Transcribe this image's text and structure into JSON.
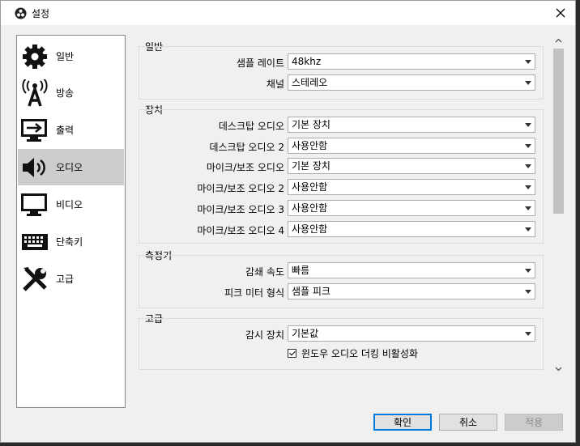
{
  "window": {
    "title": "설정"
  },
  "sidebar": {
    "items": [
      {
        "label": "일반",
        "icon": "gear-icon"
      },
      {
        "label": "방송",
        "icon": "broadcast-antenna-icon"
      },
      {
        "label": "출력",
        "icon": "output-monitor-icon"
      },
      {
        "label": "오디오",
        "icon": "speaker-icon",
        "selected": true
      },
      {
        "label": "비디오",
        "icon": "monitor-icon"
      },
      {
        "label": "단축키",
        "icon": "keyboard-icon"
      },
      {
        "label": "고급",
        "icon": "tools-icon"
      }
    ]
  },
  "general": {
    "title": "일반",
    "rows": [
      {
        "label": "샘플 레이트",
        "value": "48khz"
      },
      {
        "label": "채널",
        "value": "스테레오"
      }
    ]
  },
  "devices": {
    "title": "장치",
    "rows": [
      {
        "label": "데스크탑 오디오",
        "value": "기본 장치"
      },
      {
        "label": "데스크탑 오디오 2",
        "value": "사용안함"
      },
      {
        "label": "마이크/보조 오디오",
        "value": "기본 장치"
      },
      {
        "label": "마이크/보조 오디오 2",
        "value": "사용안함"
      },
      {
        "label": "마이크/보조 오디오 3",
        "value": "사용안함"
      },
      {
        "label": "마이크/보조 오디오 4",
        "value": "사용안함"
      }
    ]
  },
  "meters": {
    "title": "측정기",
    "rows": [
      {
        "label": "감쇄 속도",
        "value": "빠름"
      },
      {
        "label": "피크 미터 형식",
        "value": "샘플 피크"
      }
    ]
  },
  "advanced": {
    "title": "고급",
    "rows": [
      {
        "label": "감시 장치",
        "value": "기본값"
      }
    ],
    "checkbox": {
      "label": "윈도우 오디오 더킹 비활성화",
      "checked": true
    }
  },
  "buttons": {
    "ok": "확인",
    "cancel": "취소",
    "apply": "적용"
  },
  "colors": {
    "selected_bg": "#cdcdcd",
    "primary_border": "#0078d7"
  }
}
